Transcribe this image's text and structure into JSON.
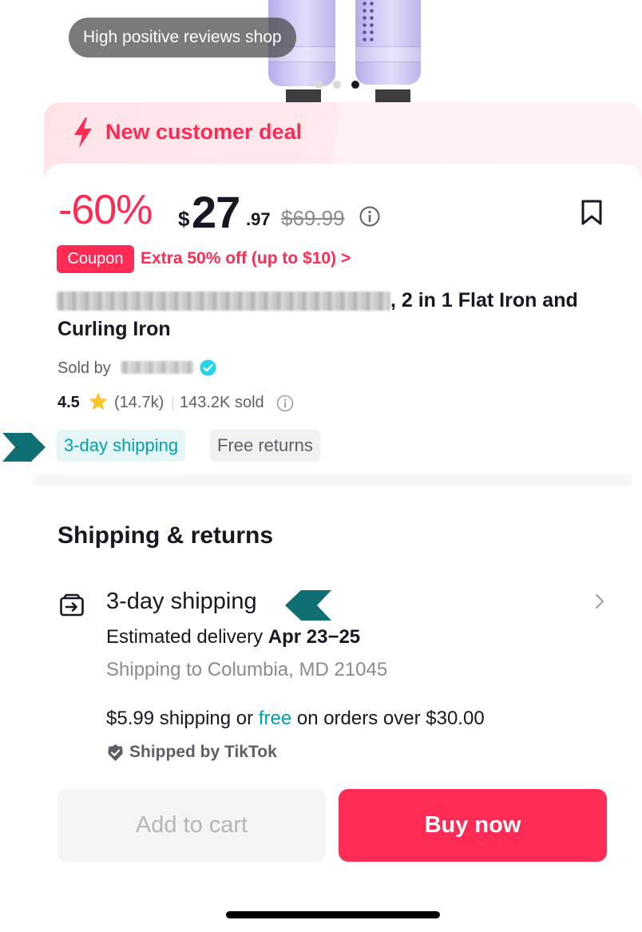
{
  "hero": {
    "badge": "High positive reviews shop",
    "carousel_total": 3,
    "carousel_active": 3
  },
  "deal": {
    "icon": "lightning-icon",
    "label": "New customer deal"
  },
  "price": {
    "discount": "-60%",
    "currency": "$",
    "integer": "27",
    "decimal": ".97",
    "original": "$69.99"
  },
  "coupon": {
    "tag": "Coupon",
    "text": "Extra 50% off (up to $10) >"
  },
  "product": {
    "title_line1": ", 2 in 1 Flat Iron and",
    "title_line2": "Curling Iron"
  },
  "seller": {
    "label": "Sold by"
  },
  "stats": {
    "rating": "4.5",
    "reviews": "(14.7k)",
    "sold": "143.2K sold"
  },
  "tags": {
    "shipping": "3-day shipping",
    "returns": "Free returns"
  },
  "shipping_section": {
    "heading": "Shipping & returns",
    "title": "3-day shipping",
    "estimated_label": "Estimated delivery",
    "estimated_dates": "Apr 23−25",
    "destination": "Shipping to Columbia, MD 21045",
    "cost_prefix": "$5.99 shipping or",
    "cost_free": "free",
    "cost_suffix": "on orders over $30.00",
    "shipped_by": "Shipped by TikTok"
  },
  "actions": {
    "add_to_cart": "Add to cart",
    "buy_now": "Buy now"
  },
  "colors": {
    "brand": "#fe2c55",
    "teal": "#00a0ad",
    "annotation_arrow": "#0f6f73"
  }
}
